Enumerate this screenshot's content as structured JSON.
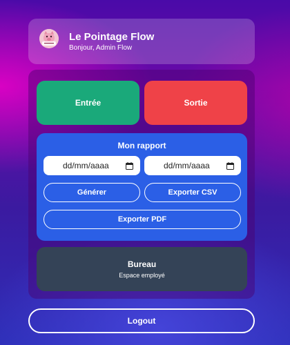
{
  "header": {
    "app_title": "Le Pointage Flow",
    "greeting": "Bonjour, Admin Flow",
    "logo_icon": "pig-mascot-icon"
  },
  "actions": {
    "entree_label": "Entrée",
    "sortie_label": "Sortie",
    "entree_color": "#1aa97a",
    "sortie_color": "#ef4248"
  },
  "report": {
    "title": "Mon rapport",
    "date_from_placeholder": "dd/mm/aaaa",
    "date_to_placeholder": "dd/mm/aaaa",
    "generate_label": "Générer",
    "export_csv_label": "Exporter CSV",
    "export_pdf_label": "Exporter PDF",
    "card_color": "#2b5fe6",
    "calendar_icon": "calendar-icon"
  },
  "bureau": {
    "title": "Bureau",
    "subtitle": "Espace employé",
    "card_color": "#344357"
  },
  "footer": {
    "logout_label": "Logout"
  }
}
